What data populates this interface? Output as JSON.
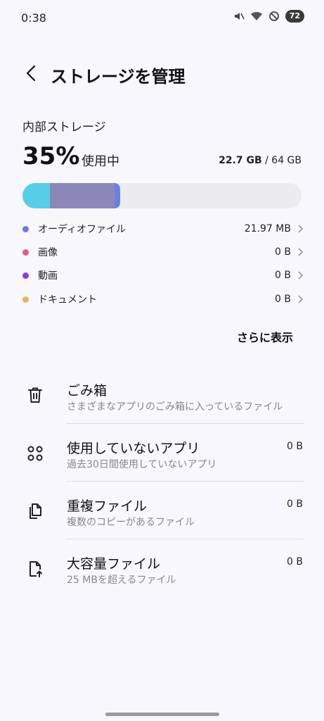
{
  "status": {
    "time": "0:38",
    "battery": "72"
  },
  "header": {
    "title": "ストレージを管理"
  },
  "storage": {
    "section_label": "内部ストレージ",
    "percent": "35%",
    "percent_suffix": "使用中",
    "used": "22.7 GB",
    "separator": " / ",
    "total": "64 GB",
    "bar": {
      "used_fraction": 0.35,
      "colors": [
        "#58cde8",
        "#8b88b8",
        "#6b7fe0"
      ]
    }
  },
  "categories": [
    {
      "name": "オーディオファイル",
      "size": "21.97 MB",
      "color": "#6e78e0"
    },
    {
      "name": "画像",
      "size": "0 B",
      "color": "#e06080"
    },
    {
      "name": "動画",
      "size": "0 B",
      "color": "#8b3fd0"
    },
    {
      "name": "ドキュメント",
      "size": "0 B",
      "color": "#e8b060"
    }
  ],
  "more_label": "さらに表示",
  "items": [
    {
      "title": "ごみ箱",
      "subtitle": "さまざまなアプリのごみ箱に入っているファイル",
      "value": "",
      "icon": "trash-icon"
    },
    {
      "title": "使用していないアプリ",
      "subtitle": "過去30日間使用していないアプリ",
      "value": "0 B",
      "icon": "apps-icon"
    },
    {
      "title": "重複ファイル",
      "subtitle": "複数のコピーがあるファイル",
      "value": "0 B",
      "icon": "duplicate-file-icon"
    },
    {
      "title": "大容量ファイル",
      "subtitle": "25 MBを超えるファイル",
      "value": "0 B",
      "icon": "large-file-icon"
    }
  ]
}
